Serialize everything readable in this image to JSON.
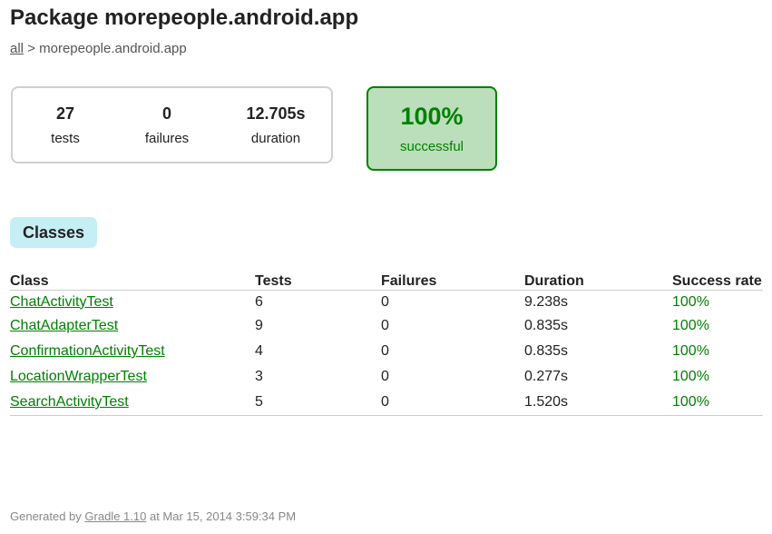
{
  "title": "Package morepeople.android.app",
  "breadcrumb": {
    "root_link": "all",
    "separator": ">",
    "current": "morepeople.android.app"
  },
  "summary": {
    "tests": {
      "value": "27",
      "label": "tests"
    },
    "failures": {
      "value": "0",
      "label": "failures"
    },
    "duration": {
      "value": "12.705s",
      "label": "duration"
    }
  },
  "success_rate": {
    "value": "100%",
    "label": "successful"
  },
  "tabs": [
    {
      "label": "Classes"
    }
  ],
  "table": {
    "headers": [
      "Class",
      "Tests",
      "Failures",
      "Duration",
      "Success rate"
    ],
    "rows": [
      [
        "ChatActivityTest",
        "6",
        "0",
        "9.238s",
        "100%"
      ],
      [
        "ChatAdapterTest",
        "9",
        "0",
        "0.835s",
        "100%"
      ],
      [
        "ConfirmationActivityTest",
        "4",
        "0",
        "0.835s",
        "100%"
      ],
      [
        "LocationWrapperTest",
        "3",
        "0",
        "0.277s",
        "100%"
      ],
      [
        "SearchActivityTest",
        "5",
        "0",
        "1.520s",
        "100%"
      ]
    ]
  },
  "footer": {
    "prefix": "Generated by",
    "link": "Gradle 1.10",
    "suffix": "at Mar 15, 2014 3:59:34 PM"
  },
  "colors": {
    "success_green": "#008000",
    "success_box_bg": "#bbdfbb",
    "tab_bg": "#c6eef5"
  }
}
